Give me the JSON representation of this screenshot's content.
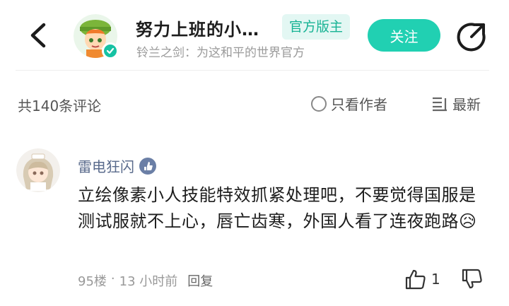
{
  "header": {
    "title": "努力上班的小…",
    "badge": "官方版主",
    "subtitle": "铃兰之剑：为这和平的世界官方",
    "follow_label": "关注"
  },
  "comment_bar": {
    "count_text": "共140条评论",
    "author_only_label": "只看作者",
    "sort_label": "最新"
  },
  "comment": {
    "username": "雷电狂闪",
    "text": "立绘像素小人技能特效抓紧处理吧，不要觉得国服是测试服就不上心，唇亡齿寒，外国人看了连夜跑路😥",
    "floor": "95楼",
    "separator": "·",
    "time": "13 小时前",
    "reply_label": "回复",
    "like_count": "1"
  },
  "colors": {
    "accent": "#21d0b2",
    "badge_bg": "#e3f7f3",
    "badge_text": "#17b394",
    "username": "#5a6b8c"
  },
  "icons": {
    "back": "chevron-left-icon",
    "share": "share-icon",
    "radio": "circle-icon",
    "sort": "sort-lines-icon",
    "like": "thumbs-up-icon",
    "dislike": "thumbs-down-icon",
    "verified": "verified-check-icon",
    "level": "level-badge-icon"
  }
}
